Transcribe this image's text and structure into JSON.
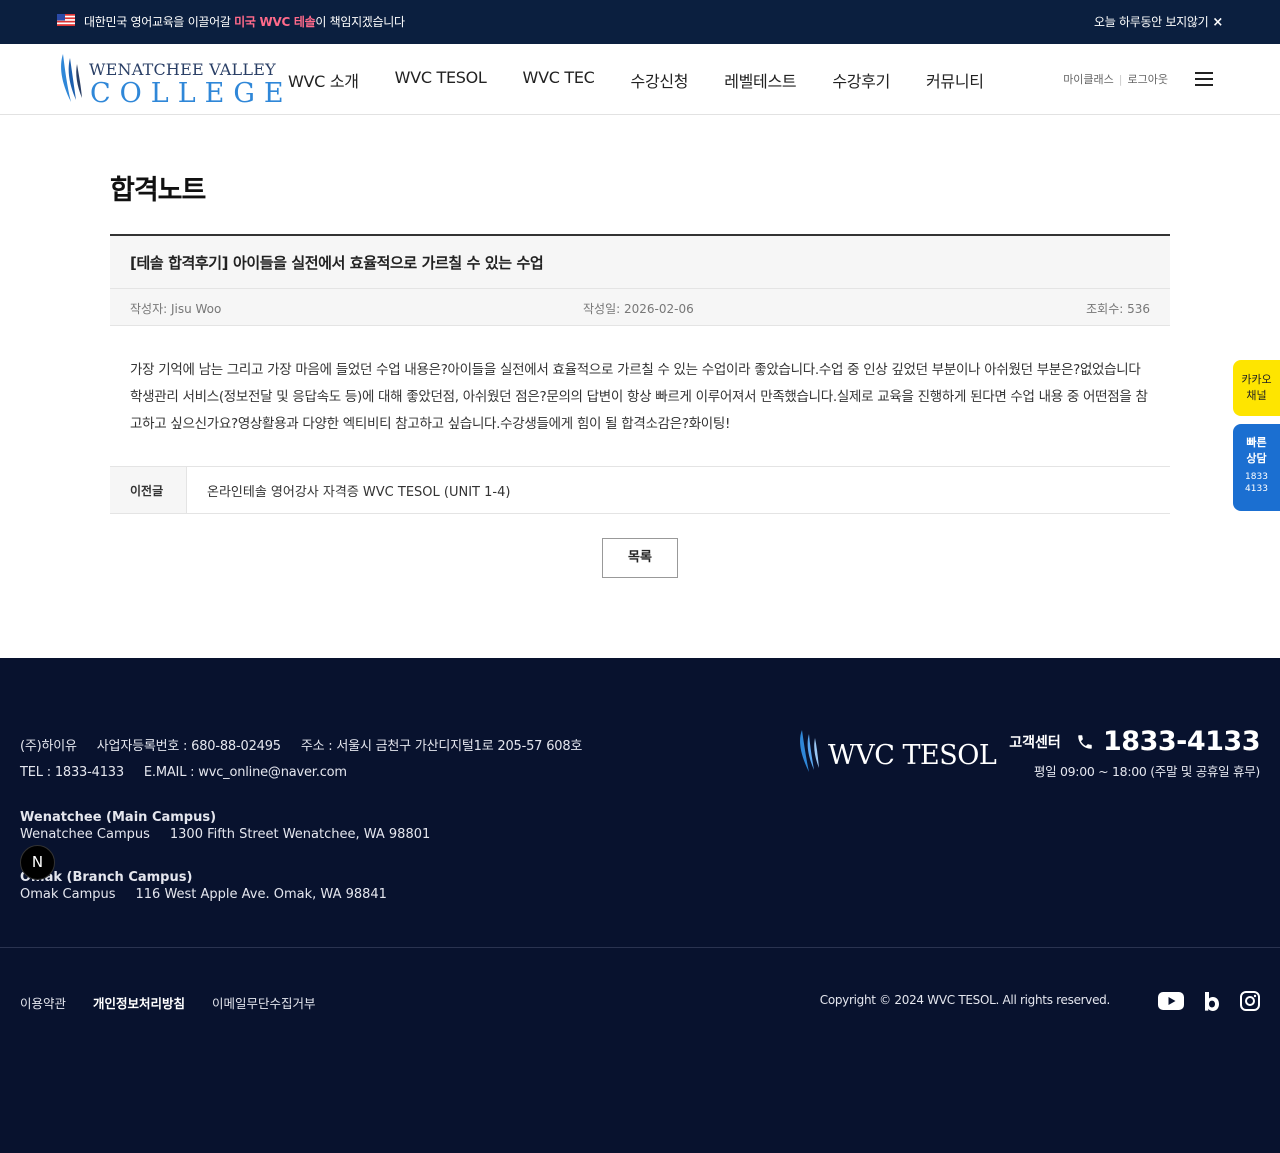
{
  "topbar": {
    "flag_icon": "us-flag-icon",
    "message_pre": "대한민국 영어교육을 이끌어갈 ",
    "message_highlight": "미국 WVC 테솔",
    "message_post": "이 책임지겠습니다",
    "close_label": "오늘 하루동안 보지않기",
    "close_symbol": "×"
  },
  "header": {
    "logo_line1": "WENATCHEE VALLEY",
    "logo_line2": "COLLEGE",
    "nav": [
      "WVC 소개",
      "WVC TESOL",
      "WVC TEC",
      "수강신청",
      "레벨테스트",
      "수강후기",
      "커뮤니티"
    ],
    "util_mypage": "마이클래스",
    "util_sep": "|",
    "util_login": "로그아웃"
  },
  "page": {
    "title": "합격노트",
    "post": {
      "title": "[테솔 합격후기] 아이들을 실전에서 효율적으로 가르칠 수 있는 수업",
      "author": "작성자: Jisu Woo",
      "date": "작성일: 2026-02-06",
      "views": "조회수: 536",
      "body": "가장 기억에 남는 그리고 가장 마음에 들었던 수업 내용은?아이들을 실전에서 효율적으로 가르칠 수 있는 수업이라 좋았습니다.수업 중 인상 깊었던 부분이나 아쉬웠던 부분은?없었습니다학생관리 서비스(정보전달 및 응답속도 등)에 대해 좋았던점, 아쉬웠던 점은?문의의 답변이 항상 빠르게 이루어져서 만족했습니다.실제로 교육을 진행하게 된다면 수업 내용 중 어떤점을 참고하고 싶으신가요?영상활용과 다양한 엑티비티 참고하고 싶습니다.수강생들에게 힘이 될 합격소감은?화이팅!"
    },
    "prev_label": "이전글",
    "prev_title": "온라인테솔 영어강사 자격증 WVC TESOL (UNIT 1-4)",
    "list_button": "목록"
  },
  "side": {
    "kakao_line1": "카카오",
    "kakao_line2": "채널",
    "quick_line1": "빠른",
    "quick_line2": "상담",
    "quick_num1": "1833",
    "quick_num2": "4133"
  },
  "footer": {
    "company": "(주)하이유",
    "biz_no": "사업자등록번호 : 680-88-02495",
    "address": "주소 : 서울시 금천구 가산디지털1로 205-57 608호",
    "tel": "TEL : 1833-4133",
    "email": "E.MAIL : wvc_online@naver.com",
    "campus1_title": "Wenatchee (Main Campus)",
    "campus1_name": "Wenatchee Campus",
    "campus1_addr": "1300 Fifth Street Wenatchee, WA 98801",
    "campus2_title": "Omak (Branch Campus)",
    "campus2_name": "Omak Campus",
    "campus2_addr": "116 West Apple Ave. Omak, WA 98841",
    "logo_text": "WVC TESOL",
    "cs_label": "고객센터",
    "cs_number": "1833-4133",
    "cs_hours": "평일 09:00 ~ 18:00 (주말 및 공휴일 휴무)",
    "links": [
      "이용약관",
      "개인정보처리방침",
      "이메일무단수집거부"
    ],
    "copyright": "Copyright © 2024 WVC TESOL. All rights reserved.",
    "social": [
      "youtube-icon",
      "blog-icon",
      "instagram-icon"
    ]
  },
  "floating_badge": "N",
  "colors": {
    "topbar_bg": "#0b1f3f",
    "highlight": "#ff6a8a",
    "footer_bg": "#08122e",
    "kakao": "#fee500",
    "quick": "#1b6fd1",
    "logo_blue": "#2f87d8"
  }
}
